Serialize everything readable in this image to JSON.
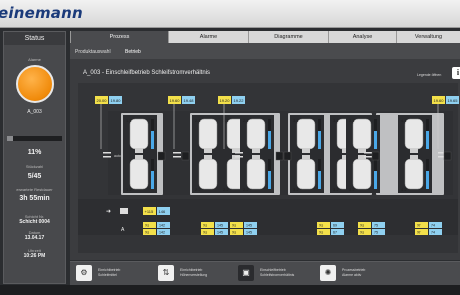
{
  "brand": "einemann",
  "status": {
    "title": "Status",
    "alarm_label": "Alarme",
    "machine": "A_003",
    "progress": {
      "value": 0.11,
      "text": "11%"
    },
    "stueckzahl_label": "Stückzahl",
    "stueckzahl": "5/45",
    "restdauer_label": "erwartete Restdauer",
    "restdauer": "3h 55min",
    "schicht_label": "Schicht Nr.",
    "schicht": "Schicht 0004",
    "datum_label": "Datum",
    "datum": "13.04.17",
    "uhrzeit_label": "Uhrzeit",
    "uhrzeit": "10:26 PM"
  },
  "tabs": [
    "Prozess",
    "Alarme",
    "Diagramme",
    "Analyse",
    "Verwaltung"
  ],
  "active_tab": 0,
  "subnav": [
    "Produktauswahl",
    "Betrieb"
  ],
  "main": {
    "title": "A_003 - Einschleifbetrieb Schleifstromverhältnis",
    "legend_label": "Legende öffnen",
    "legend_icon": "info-icon",
    "stations": [
      {
        "id": "1.1",
        "bottom": "1.2",
        "val_a": "20.00",
        "val_b": "19.80"
      },
      {
        "id": "2.1",
        "bottom": "2.2",
        "val_a": "19.60",
        "val_b": "19.48"
      },
      {
        "id": "2.1",
        "bottom": "2.2",
        "val_a": "19.20",
        "val_b": "19.22"
      },
      {
        "id": "3.1",
        "bottom": "3.2",
        "val_a": "",
        "val_b": ""
      },
      {
        "id": "3.1",
        "bottom": "3.2",
        "val_a": "",
        "val_b": ""
      },
      {
        "id": "4.1",
        "bottom": "4.2",
        "val_a": "19.60",
        "val_b": "19.65"
      }
    ],
    "auto_label": "auto",
    "feed_row": {
      "a": "+115",
      "b": "146"
    },
    "xs_pairs": [
      {
        "k1": "Xs",
        "v1": "142",
        "k2": "Xs",
        "v2": "142"
      },
      {
        "k1": "Xs",
        "v1": "145",
        "k2": "Xs",
        "v2": "145"
      },
      {
        "k1": "Xs",
        "v1": "145",
        "k2": "Xs",
        "v2": "145"
      },
      {
        "k1": "Xs",
        "v1": "69",
        "k2": "Xs",
        "v2": "67"
      },
      {
        "k1": "Xs",
        "v1": "75",
        "k2": "Xs",
        "v2": "75"
      },
      {
        "k1": "Xf",
        "v1": "74",
        "k2": "Xf",
        "v2": "74"
      }
    ]
  },
  "footer": [
    {
      "icon": "gear-icon",
      "label1": "Einrichtbetrieb",
      "label2": "Schleifmittel"
    },
    {
      "icon": "sliders-icon",
      "label1": "Einrichtbetrieb",
      "label2": "Höhenverstellung"
    },
    {
      "icon": "machine-icon",
      "label1": "Einschleifbetrieb",
      "label2": "Schleifstromverhältnis"
    },
    {
      "icon": "spinner-icon",
      "label1": "Prozessbetrieb",
      "label2": "Alarme aktiv"
    }
  ],
  "colors": {
    "yellow": "#f3e04a",
    "blue": "#8fd0f0",
    "orange": "#f08a0a",
    "level_blue": "#4aa8e8"
  }
}
